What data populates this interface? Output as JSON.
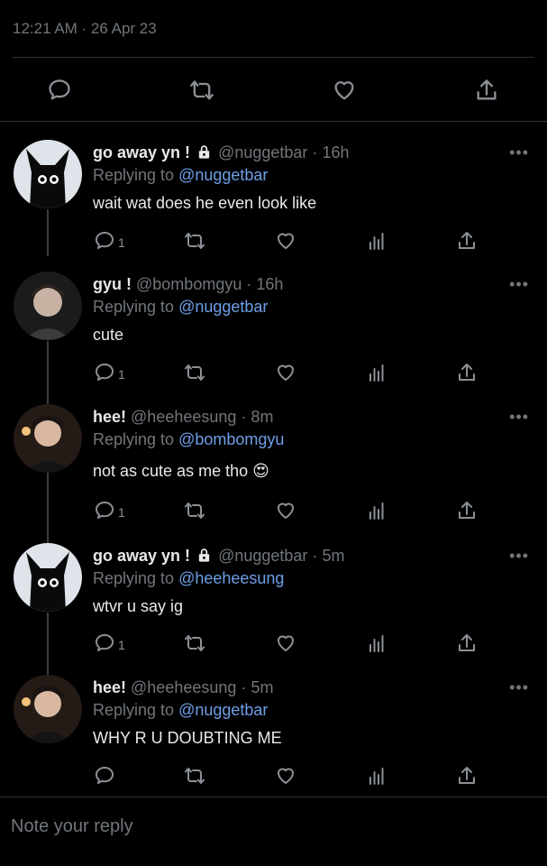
{
  "header": {
    "timestamp": "12:21 AM · 26 Apr 23"
  },
  "tweets": [
    {
      "name": "go away yn !",
      "locked": true,
      "handle": "@nuggetbar",
      "time": "16h",
      "replying_prefix": "Replying to",
      "replying_to": "@nuggetbar",
      "text": "wait wat does he even look like",
      "reply_count": "1",
      "avatar": "black-cat-avatar"
    },
    {
      "name": "gyu !",
      "locked": false,
      "handle": "@bombomgyu",
      "time": "16h",
      "replying_prefix": "Replying to",
      "replying_to": "@nuggetbar",
      "text": "cute",
      "reply_count": "1",
      "avatar": "person-avatar"
    },
    {
      "name": "hee!",
      "locked": false,
      "handle": "@heeheesung",
      "time": "8m",
      "replying_prefix": "Replying to",
      "replying_to": "@bombomgyu",
      "text": "not as cute as me tho",
      "emoji": "😍",
      "reply_count": "1",
      "avatar": "person-avatar"
    },
    {
      "name": "go away yn !",
      "locked": true,
      "handle": "@nuggetbar",
      "time": "5m",
      "replying_prefix": "Replying to",
      "replying_to": "@heeheesung",
      "text": "wtvr u say ig",
      "reply_count": "1",
      "avatar": "black-cat-avatar"
    },
    {
      "name": "hee!",
      "locked": false,
      "handle": "@heeheesung",
      "time": "5m",
      "replying_prefix": "Replying to",
      "replying_to": "@nuggetbar",
      "text": "WHY R U DOUBTING ME",
      "reply_count": "",
      "avatar": "person-avatar"
    }
  ],
  "more_label": "•••",
  "reply_placeholder": "Note your reply",
  "colors": {
    "background": "#000000",
    "text": "#e7e9ea",
    "muted": "#71767b",
    "mention": "#6e9ee8"
  }
}
